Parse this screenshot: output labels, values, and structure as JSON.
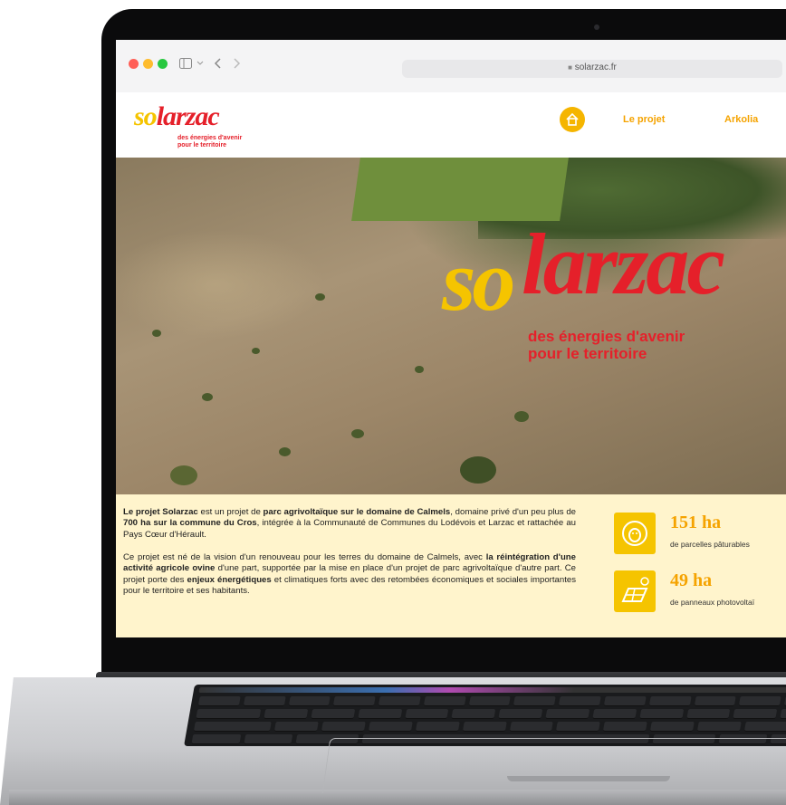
{
  "browser": {
    "url": "solarzac.fr"
  },
  "site": {
    "logo": {
      "so": "so",
      "larzac": "larzac",
      "tagline_line1": "des énergies d'avenir",
      "tagline_line2": "pour le territoire"
    },
    "nav": {
      "items": [
        "Le projet",
        "Arkolia"
      ]
    }
  },
  "hero": {
    "title_so": "so",
    "title_larzac": "larzac",
    "tagline_line1": "des énergies d'avenir",
    "tagline_line2": "pour le territoire"
  },
  "intro": {
    "p1": {
      "a": "Le projet Solarzac",
      "b": " est un projet de ",
      "c": "parc agrivoltaïque sur le domaine de Calmels",
      "d": ", domaine privé d'un peu plus de ",
      "e": "700 ha sur la commune du Cros",
      "f": ", intégrée à la Communauté de Communes du Lodévois et Larzac et rattachée au Pays Cœur d'Hérault."
    },
    "p2": {
      "a": "Ce projet est né de la vision d'un renouveau pour les terres du domaine de Calmels, avec ",
      "b": "la réintégration d'une activité agricole ovine",
      "c": " d'une part, supportée par la mise en place d'un projet de parc agrivoltaïque d'autre part. Ce projet porte des ",
      "d": "enjeux énergétiques",
      "e": " et climatiques forts avec des retombées économiques et sociales importantes pour le territoire et ses habitants."
    }
  },
  "stats": [
    {
      "value": "151 ha",
      "label": "de parcelles pâturables",
      "icon": "sheep-icon"
    },
    {
      "value": "49 ha",
      "label": "de panneaux photovoltaï",
      "icon": "solar-panel-icon"
    }
  ],
  "colors": {
    "brand_red": "#e5202a",
    "brand_yellow": "#f5c400",
    "nav_orange": "#f5a300",
    "band_bg": "#fff4cc"
  }
}
